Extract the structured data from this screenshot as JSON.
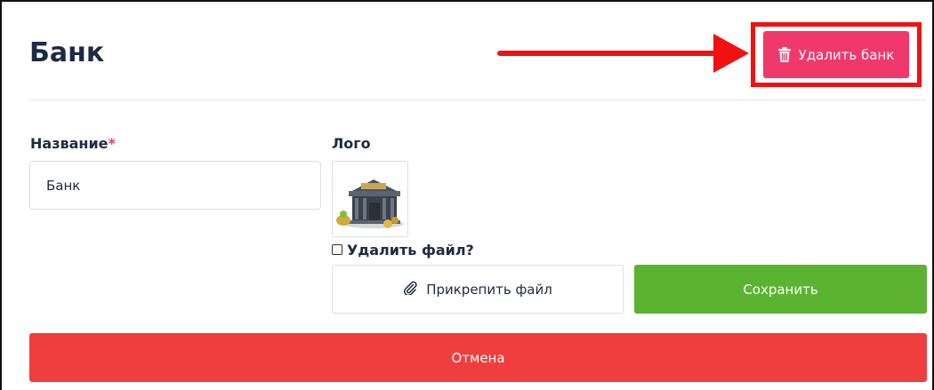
{
  "page": {
    "title": "Банк"
  },
  "header": {
    "delete_bank_label": "Удалить банк",
    "delete_icon": "trash-icon"
  },
  "form": {
    "name_label": "Название",
    "required_mark": "*",
    "name_value": "Банк",
    "logo_label": "Лого",
    "logo_image": "bank-building-icon",
    "delete_file_label": "Удалить файл?",
    "delete_file_checked": false,
    "attach_label": "Прикрепить файл",
    "attach_icon": "paperclip-icon",
    "save_label": "Сохранить",
    "cancel_label": "Отмена"
  },
  "colors": {
    "delete_button": "#f1386a",
    "save_button": "#5ab431",
    "cancel_button": "#f03e3e",
    "annotation": "#f21111",
    "title_text": "#1e2a44"
  }
}
